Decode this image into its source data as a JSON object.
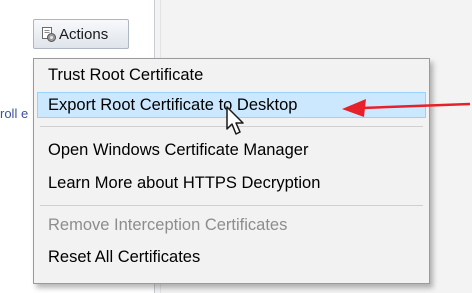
{
  "toolbar": {
    "actions_label": "Actions"
  },
  "sidebar": {
    "partial_text": "roll e"
  },
  "menu": {
    "items": [
      {
        "label": "Trust Root Certificate",
        "state": "normal"
      },
      {
        "label": "Export Root Certificate to Desktop",
        "state": "hover"
      },
      {
        "label": "Open Windows Certificate Manager",
        "state": "normal"
      },
      {
        "label": "Learn More about HTTPS Decryption",
        "state": "normal"
      },
      {
        "label": "Remove Interception Certificates",
        "state": "disabled"
      },
      {
        "label": "Reset All Certificates",
        "state": "normal"
      }
    ]
  },
  "icons": {
    "actions": "gear-certificate-icon",
    "annotation": "red-arrow-icon",
    "pointer": "mouse-cursor-icon"
  },
  "colors": {
    "highlight_fill": "#cce8ff",
    "highlight_border": "#99d1ff",
    "annotation_arrow": "#e8202a",
    "disabled_text": "#8d8d8d",
    "link_text": "#3c4fa3"
  }
}
